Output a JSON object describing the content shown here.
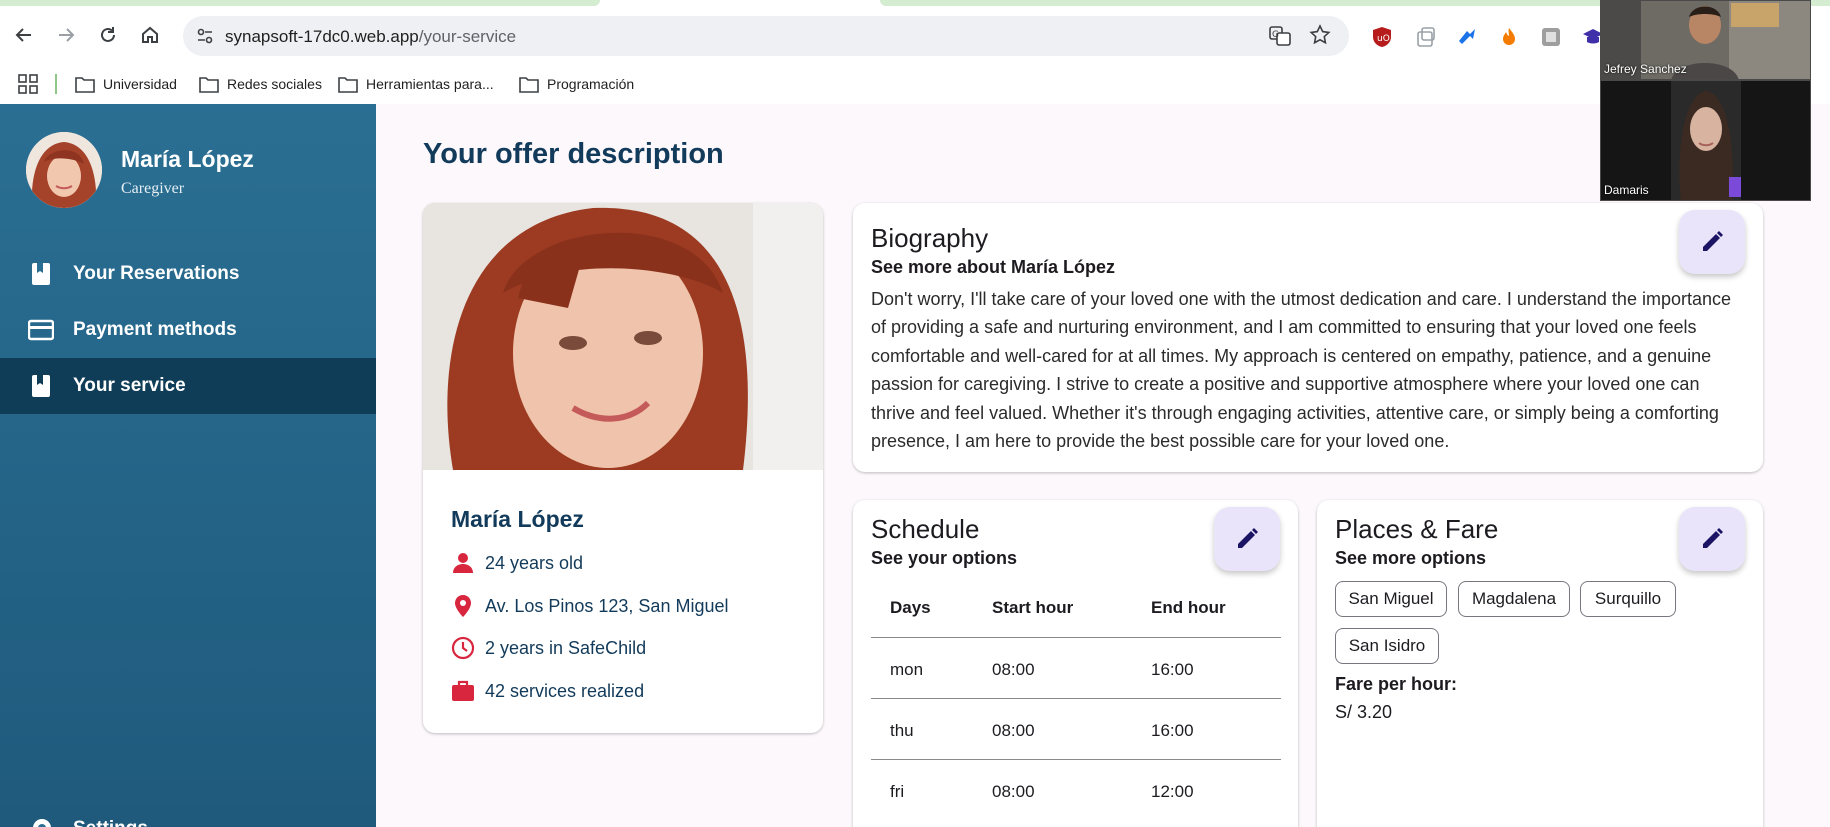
{
  "browser": {
    "url_domain": "synapsoft-17dc0.web.app",
    "url_path": "/your-service",
    "bookmarks": [
      "Universidad",
      "Redes sociales",
      "Herramientas para...",
      "Programación"
    ]
  },
  "sidebar": {
    "user_name": "María López",
    "user_role": "Caregiver",
    "items": [
      {
        "label": "Your Reservations",
        "icon": "book-icon"
      },
      {
        "label": "Payment methods",
        "icon": "credit-card-icon"
      },
      {
        "label": "Your service",
        "icon": "book-icon",
        "active": true
      }
    ],
    "settings_label": "Settings"
  },
  "main": {
    "title": "Your offer description",
    "profile": {
      "name": "María López",
      "age": "24 years old",
      "address": "Av. Los Pinos 123, San Miguel",
      "experience": "2 years in SafeChild",
      "services": "42 services realized"
    },
    "biography": {
      "title": "Biography",
      "subtitle": "See more about María López",
      "text": "Don't worry, I'll take care of your loved one with the utmost dedication and care. I understand the importance of providing a safe and nurturing environment, and I am committed to ensuring that your loved one feels comfortable and well-cared for at all times. My approach is centered on empathy, patience, and a genuine passion for caregiving. I strive to create a positive and supportive atmosphere where your loved one can thrive and feel valued. Whether it's through engaging activities, attentive care, or simply being a comforting presence, I am here to provide the best possible care for your loved one."
    },
    "schedule": {
      "title": "Schedule",
      "subtitle": "See your options",
      "headers": [
        "Days",
        "Start hour",
        "End hour"
      ],
      "rows": [
        [
          "mon",
          "08:00",
          "16:00"
        ],
        [
          "thu",
          "08:00",
          "16:00"
        ],
        [
          "fri",
          "08:00",
          "12:00"
        ]
      ]
    },
    "places": {
      "title": "Places & Fare",
      "subtitle": "See more options",
      "districts": [
        "San Miguel",
        "Magdalena",
        "Surquillo",
        "San Isidro"
      ],
      "fare_label": "Fare per hour:",
      "fare_value": "S/ 3.20"
    }
  },
  "video_call": {
    "participants": [
      "Jefrey Sanchez",
      "Damaris"
    ]
  },
  "colors": {
    "sidebar": "#2a6f93",
    "sidebar_active": "#0f3c56",
    "title": "#123a5a",
    "icon_red": "#d9263f",
    "fab_bg": "#eae4fb",
    "fab_icon": "#1b1464"
  }
}
